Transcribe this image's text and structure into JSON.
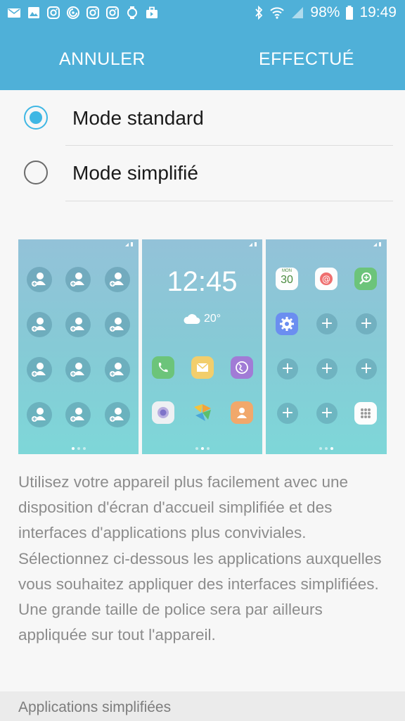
{
  "status_bar": {
    "battery": "98%",
    "time": "19:49",
    "left_icons": [
      "email-icon",
      "gallery-icon",
      "instagram-icon",
      "sync-icon",
      "instagram-icon",
      "instagram-icon",
      "watch-icon",
      "briefcase-icon"
    ],
    "right_icons": [
      "bluetooth-icon",
      "wifi-icon",
      "signal-icon",
      "battery-icon"
    ]
  },
  "action_bar": {
    "cancel_label": "ANNULER",
    "done_label": "EFFECTUÉ"
  },
  "options": [
    {
      "label": "Mode standard",
      "selected": true
    },
    {
      "label": "Mode simplifié",
      "selected": false
    }
  ],
  "preview": {
    "clock": "12:45",
    "temperature": "20°",
    "calendar_day": "MON",
    "calendar_date": "30"
  },
  "description": "Utilisez votre appareil plus facilement avec une disposition d'écran d'accueil simplifiée et des interfaces d'applications plus conviviales. Sélectionnez ci-dessous les applications auxquelles vous souhaitez appliquer des interfaces simplifiées. Une grande taille de police sera par ailleurs appliquée sur tout l'appareil.",
  "section_header": "Applications simplifiées",
  "colors": {
    "accent": "#3fb7e4",
    "header": "#4fb0d8"
  }
}
